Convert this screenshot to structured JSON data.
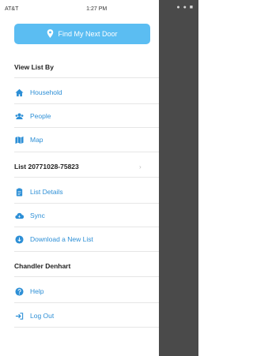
{
  "status_bar": {
    "carrier": "AT&T",
    "time": "1:27 PM",
    "right_indicators": "● ● ■"
  },
  "find_button": {
    "label": "Find My Next Door",
    "icon": "location-pin-icon"
  },
  "view_list_by": {
    "title": "View List By",
    "items": [
      {
        "label": "Household",
        "icon": "house-icon"
      },
      {
        "label": "People",
        "icon": "people-icon"
      },
      {
        "label": "Map",
        "icon": "map-icon"
      }
    ]
  },
  "list_section": {
    "title": "List 20771028-75823",
    "items": [
      {
        "label": "List Details",
        "icon": "clipboard-icon"
      },
      {
        "label": "Sync",
        "icon": "cloud-sync-icon"
      },
      {
        "label": "Download a New List",
        "icon": "download-icon"
      }
    ]
  },
  "user_section": {
    "title": "Chandler Denhart",
    "items": [
      {
        "label": "Help",
        "icon": "help-icon"
      },
      {
        "label": "Log Out",
        "icon": "logout-icon"
      }
    ]
  },
  "colors": {
    "accent": "#2d8fd6",
    "button": "#5bbdf2",
    "backdrop": "#4a4a4a"
  }
}
